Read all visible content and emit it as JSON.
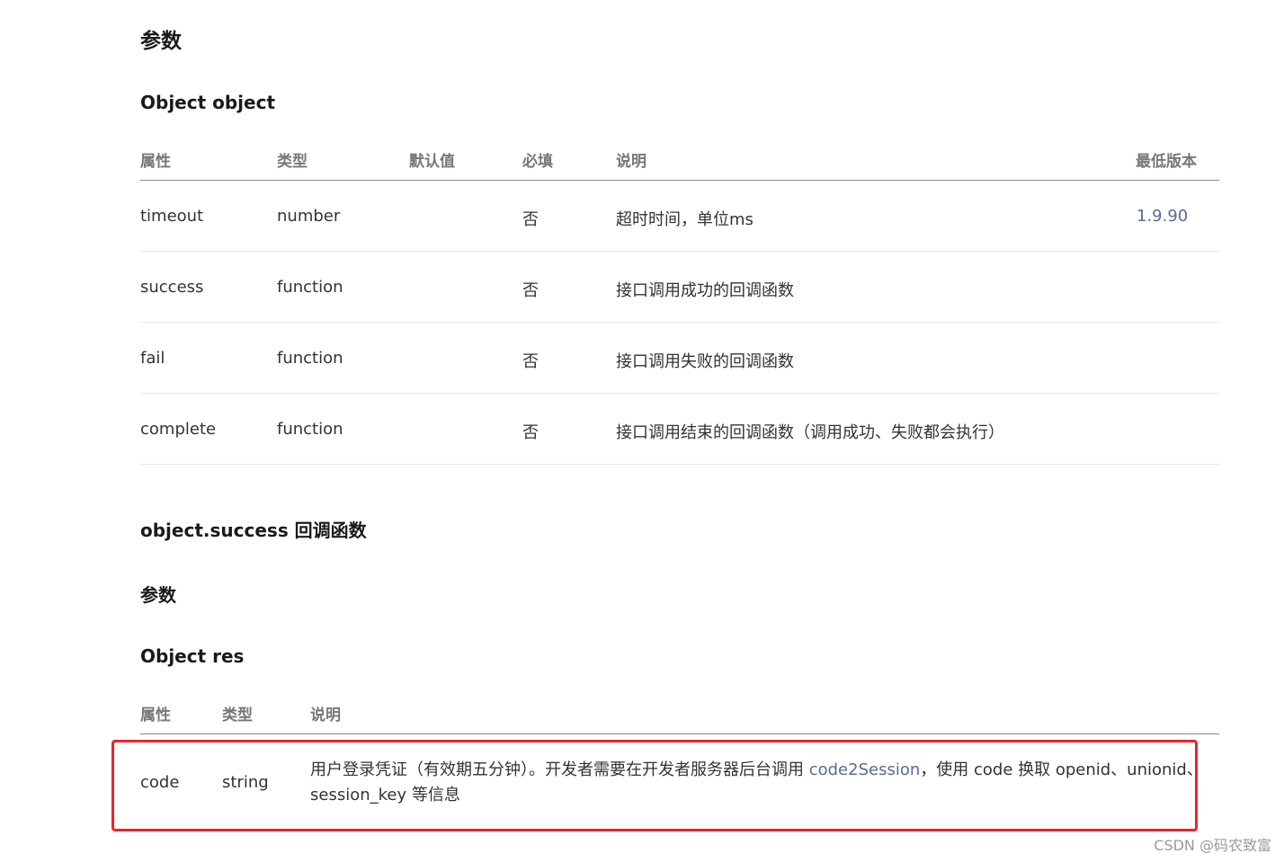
{
  "section1": {
    "title": "参数",
    "subtitle": "Object object",
    "headers": [
      "属性",
      "类型",
      "默认值",
      "必填",
      "说明",
      "最低版本"
    ],
    "rows": [
      {
        "name": "timeout",
        "type": "number",
        "default": "",
        "required": "否",
        "desc": "超时时间，单位ms",
        "version": "1.9.90"
      },
      {
        "name": "success",
        "type": "function",
        "default": "",
        "required": "否",
        "desc": "接口调用成功的回调函数",
        "version": ""
      },
      {
        "name": "fail",
        "type": "function",
        "default": "",
        "required": "否",
        "desc": "接口调用失败的回调函数",
        "version": ""
      },
      {
        "name": "complete",
        "type": "function",
        "default": "",
        "required": "否",
        "desc": "接口调用结束的回调函数（调用成功、失败都会执行）",
        "version": ""
      }
    ]
  },
  "section2": {
    "title": "object.success 回调函数",
    "params_title": "参数",
    "subtitle": "Object res",
    "headers": [
      "属性",
      "类型",
      "说明"
    ],
    "row": {
      "name": "code",
      "type": "string",
      "desc_before": "用户登录凭证（有效期五分钟）。开发者需要在开发者服务器后台调用 ",
      "desc_link": "code2Session",
      "desc_after": "，使用 code 换取 openid、unionid、session_key 等信息"
    }
  },
  "watermark": "CSDN @码农致富",
  "colors": {
    "link": "#576b95",
    "highlight_border": "#e8262a"
  }
}
